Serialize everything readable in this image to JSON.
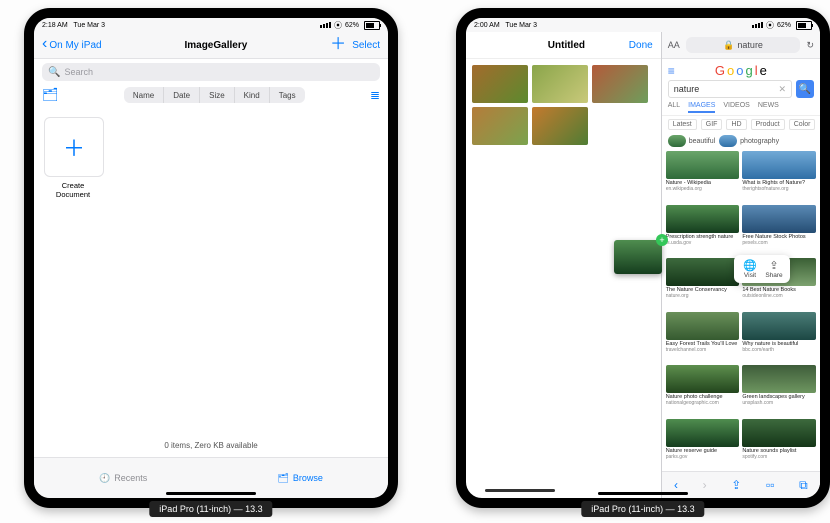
{
  "status": {
    "time_left": "2:18 AM",
    "date_left": "Tue Mar 3",
    "time_right": "2:00 AM",
    "date_right": "Tue Mar 3",
    "battery": "62%"
  },
  "left_app": {
    "back_label": "On My iPad",
    "title": "ImageGallery",
    "select_label": "Select",
    "search_placeholder": "Search",
    "sort_segments": [
      "Name",
      "Date",
      "Size",
      "Kind",
      "Tags"
    ],
    "create_doc_label": "Create Document",
    "footer_summary": "0 items, Zero KB available",
    "tabs": {
      "recents": "Recents",
      "browse": "Browse"
    }
  },
  "right_app": {
    "gallery": {
      "title": "Untitled",
      "done": "Done"
    },
    "safari": {
      "aa_label": "AA",
      "url_display": "nature",
      "lock": "🔒",
      "reload": "↻",
      "google_logo": [
        "G",
        "o",
        "o",
        "g",
        "l",
        "e"
      ],
      "search_value": "nature",
      "nav_tabs": [
        "ALL",
        "IMAGES",
        "VIDEOS",
        "NEWS"
      ],
      "filters": [
        "Latest",
        "GIF",
        "HD",
        "Product",
        "Color"
      ],
      "chips": [
        {
          "label": "beautiful",
          "sw": "n1"
        },
        {
          "label": "photography",
          "sw": "n2"
        }
      ],
      "results": [
        {
          "cap": "Nature - Wikipedia",
          "sub": "en.wikipedia.org",
          "img": "n1"
        },
        {
          "cap": "What is Rights of Nature?",
          "sub": "therightsofnature.org",
          "img": "n2"
        },
        {
          "cap": "Prescription strength nature",
          "sub": "fs.usda.gov",
          "img": "n3"
        },
        {
          "cap": "Free Nature Stock Photos",
          "sub": "pexels.com",
          "img": "n5"
        },
        {
          "cap": "The Nature Conservancy",
          "sub": "nature.org",
          "img": "n4"
        },
        {
          "cap": "14 Best Nature Books",
          "sub": "outsideonline.com",
          "img": "n6"
        },
        {
          "cap": "Easy Forest Trails You'll Love",
          "sub": "travelchannel.com",
          "img": "n7"
        },
        {
          "cap": "Why nature is beautiful",
          "sub": "bbc.com/earth",
          "img": "n8"
        },
        {
          "cap": "Nature photo challenge",
          "sub": "nationalgeographic.com",
          "img": "n9"
        },
        {
          "cap": "Green landscapes gallery",
          "sub": "unsplash.com",
          "img": "n10"
        },
        {
          "cap": "Nature reserve guide",
          "sub": "parks.gov",
          "img": "n3"
        },
        {
          "cap": "Nature sounds playlist",
          "sub": "spotify.com",
          "img": "n4"
        }
      ],
      "popover": {
        "visit": "Visit",
        "share": "Share"
      }
    }
  },
  "device_caption": "iPad Pro (11-inch) — 13.3"
}
